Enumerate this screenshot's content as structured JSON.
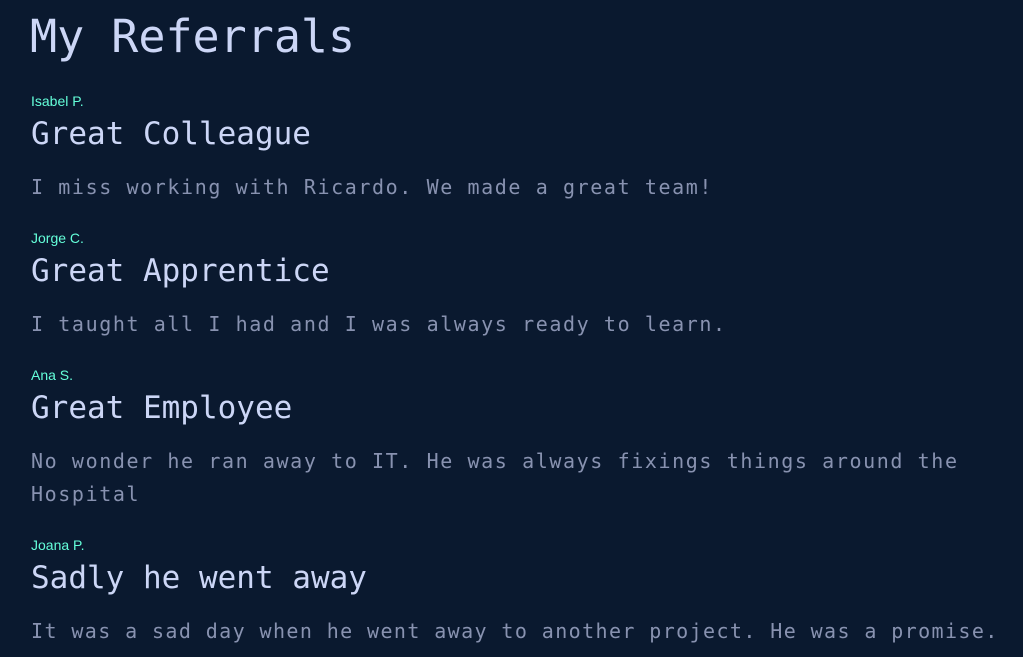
{
  "page": {
    "title": "My Referrals"
  },
  "referrals": [
    {
      "author": "Isabel P.",
      "title": "Great Colleague",
      "body": "I miss working with Ricardo. We made a great team!"
    },
    {
      "author": "Jorge C.",
      "title": "Great Apprentice",
      "body": "I taught all I had and I was always ready to learn."
    },
    {
      "author": "Ana S.",
      "title": "Great Employee",
      "body": "No wonder he ran away to IT. He was always fixings things around the Hospital"
    },
    {
      "author": "Joana P.",
      "title": "Sadly he went away",
      "body": "It was a sad day when he went away to another project. He was a promise."
    }
  ],
  "colors": {
    "background": "#0a192f",
    "heading": "#ccd6f6",
    "body_text": "#8892b0",
    "author_accent": "#64ffda"
  }
}
